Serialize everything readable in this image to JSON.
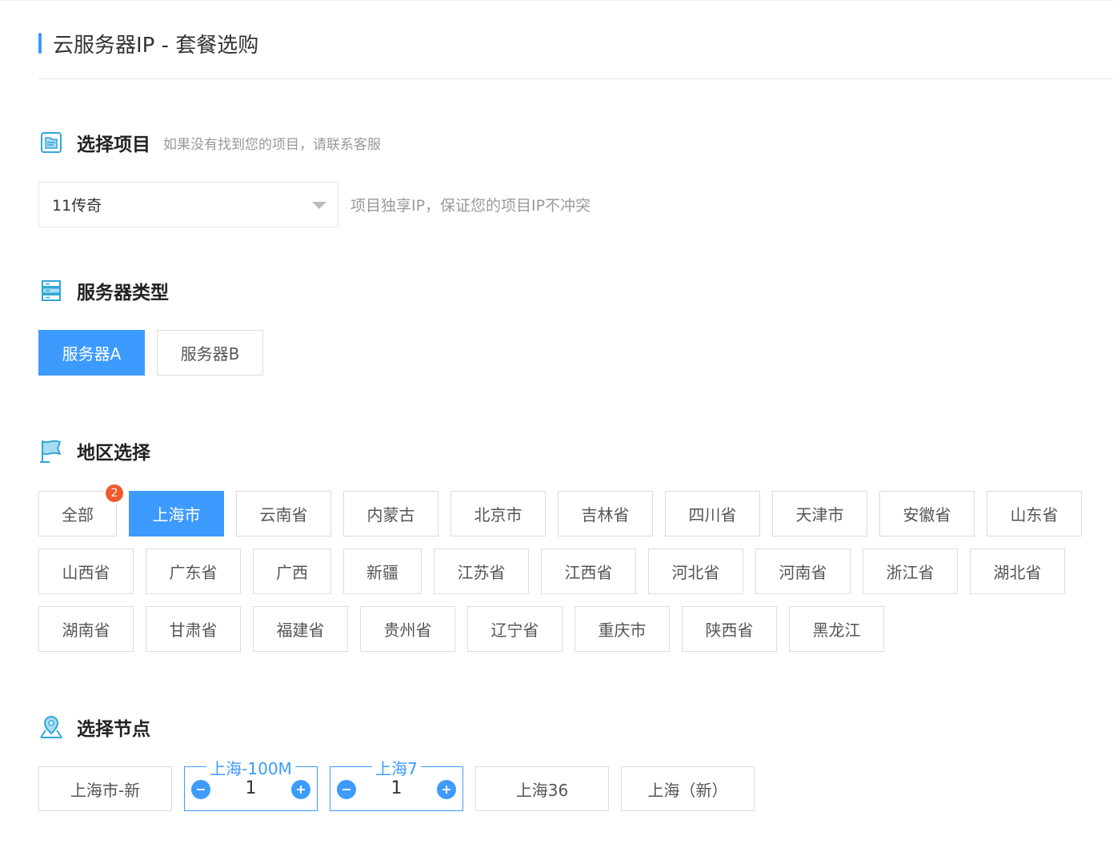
{
  "header": {
    "title": "云服务器IP - 套餐选购"
  },
  "project": {
    "title": "选择项目",
    "hint": "如果没有找到您的项目，请联系客服",
    "selected": "11传奇",
    "note": "项目独享IP，保证您的项目IP不冲突"
  },
  "server_type": {
    "title": "服务器类型",
    "options": [
      {
        "label": "服务器A",
        "active": true
      },
      {
        "label": "服务器B",
        "active": false
      }
    ]
  },
  "region": {
    "title": "地区选择",
    "badge": "2",
    "items": [
      "全部",
      "上海市",
      "云南省",
      "内蒙古",
      "北京市",
      "吉林省",
      "四川省",
      "天津市",
      "安徽省",
      "山东省",
      "山西省",
      "广东省",
      "广西",
      "新疆",
      "江苏省",
      "江西省",
      "河北省",
      "河南省",
      "浙江省",
      "湖北省",
      "湖南省",
      "甘肃省",
      "福建省",
      "贵州省",
      "辽宁省",
      "重庆市",
      "陕西省",
      "黑龙江"
    ],
    "active": "上海市"
  },
  "nodes": {
    "title": "选择节点",
    "items": [
      {
        "label": "上海市-新"
      },
      {
        "label": "上海-100M",
        "quantity": "1"
      },
      {
        "label": "上海7",
        "quantity": "1"
      },
      {
        "label": "上海36"
      },
      {
        "label": "上海（新）"
      }
    ]
  },
  "colors": {
    "accent": "#3d9bff",
    "badge": "#f25a2b"
  }
}
